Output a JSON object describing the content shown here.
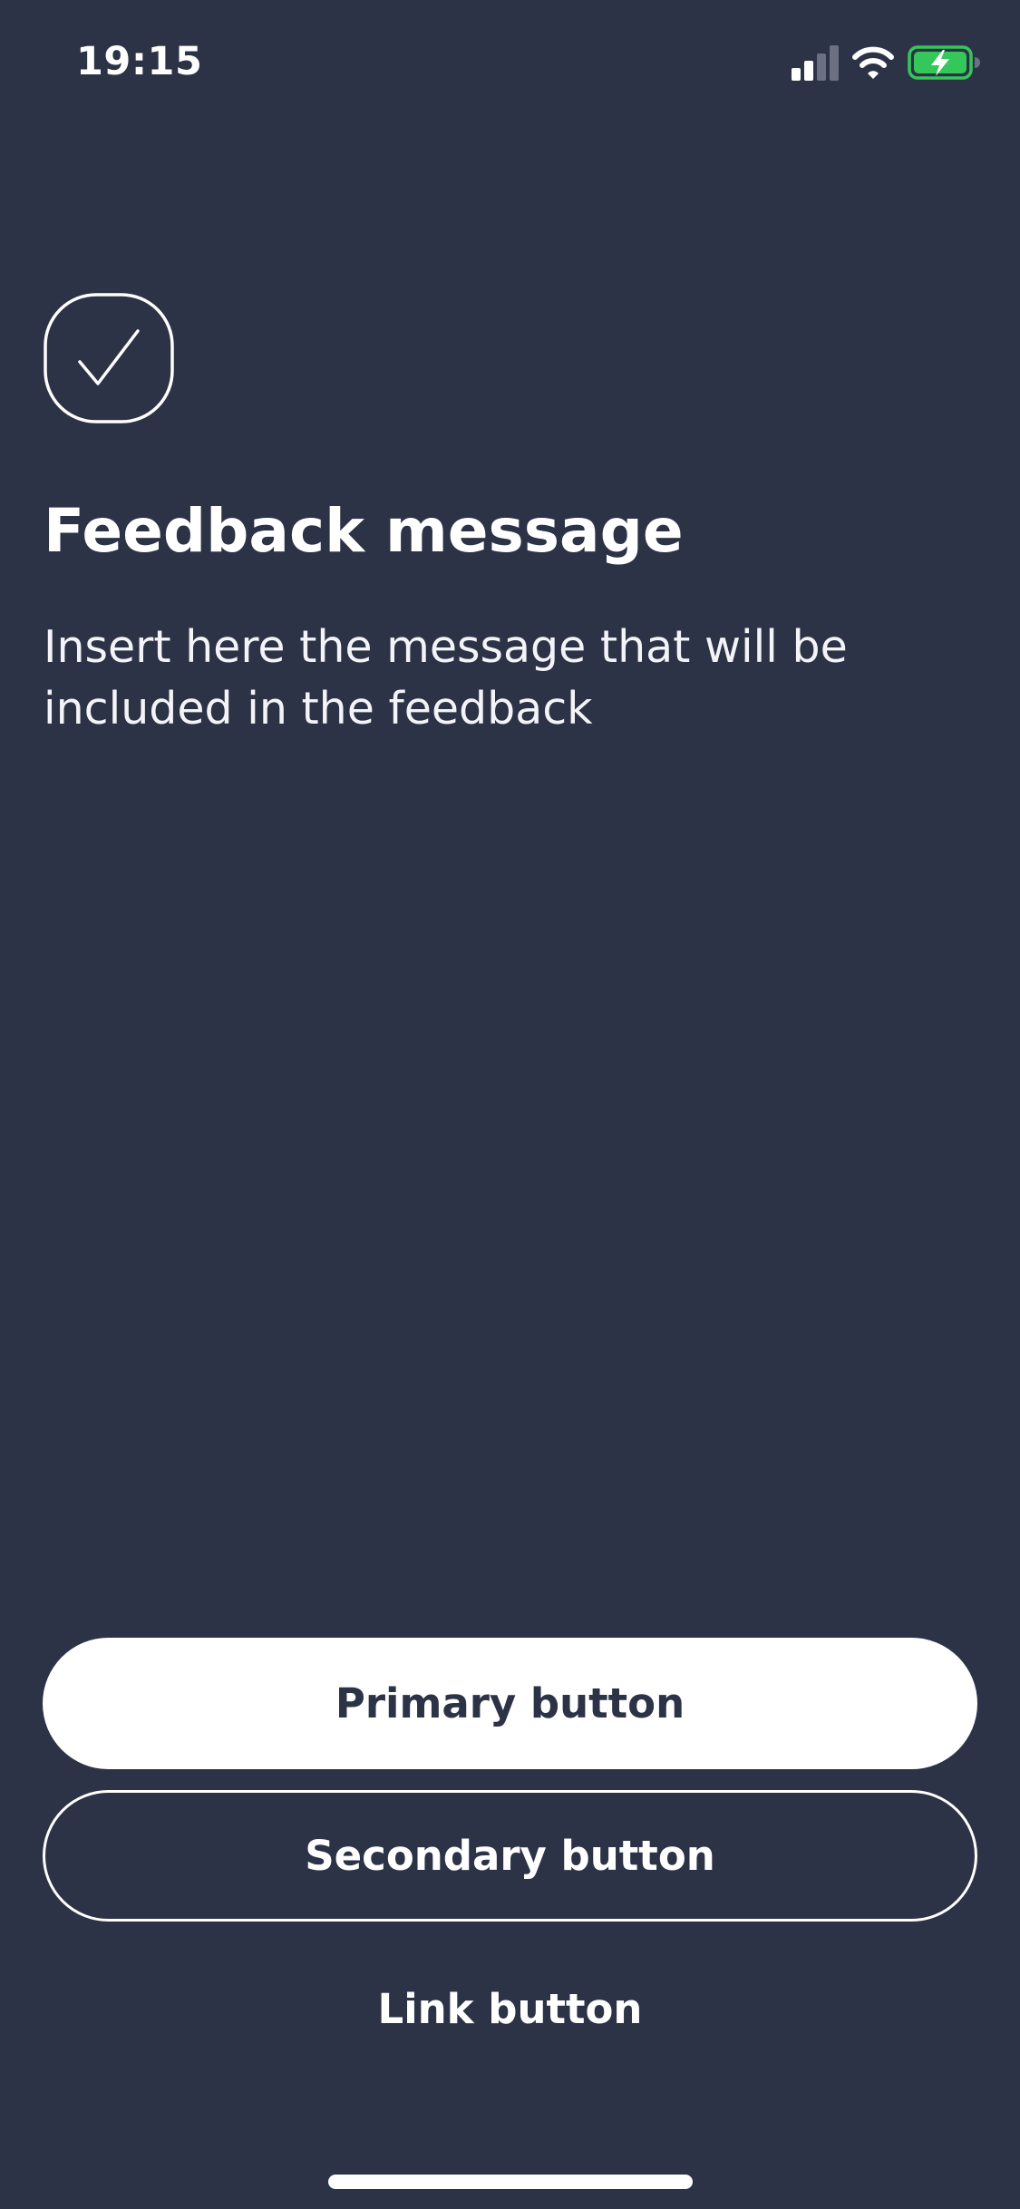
{
  "status_bar": {
    "time": "19:15",
    "icons": [
      "cellular-signal-icon",
      "wifi-icon",
      "battery-charging-icon"
    ],
    "battery_color": "#35c759"
  },
  "feedback": {
    "icon": "check-icon",
    "title": "Feedback message",
    "message": "Insert here the message that will be included in the feedback"
  },
  "actions": {
    "primary_label": "Primary button",
    "secondary_label": "Secondary button",
    "link_label": "Link button"
  },
  "colors": {
    "background": "#2c3346",
    "foreground": "#ffffff"
  }
}
